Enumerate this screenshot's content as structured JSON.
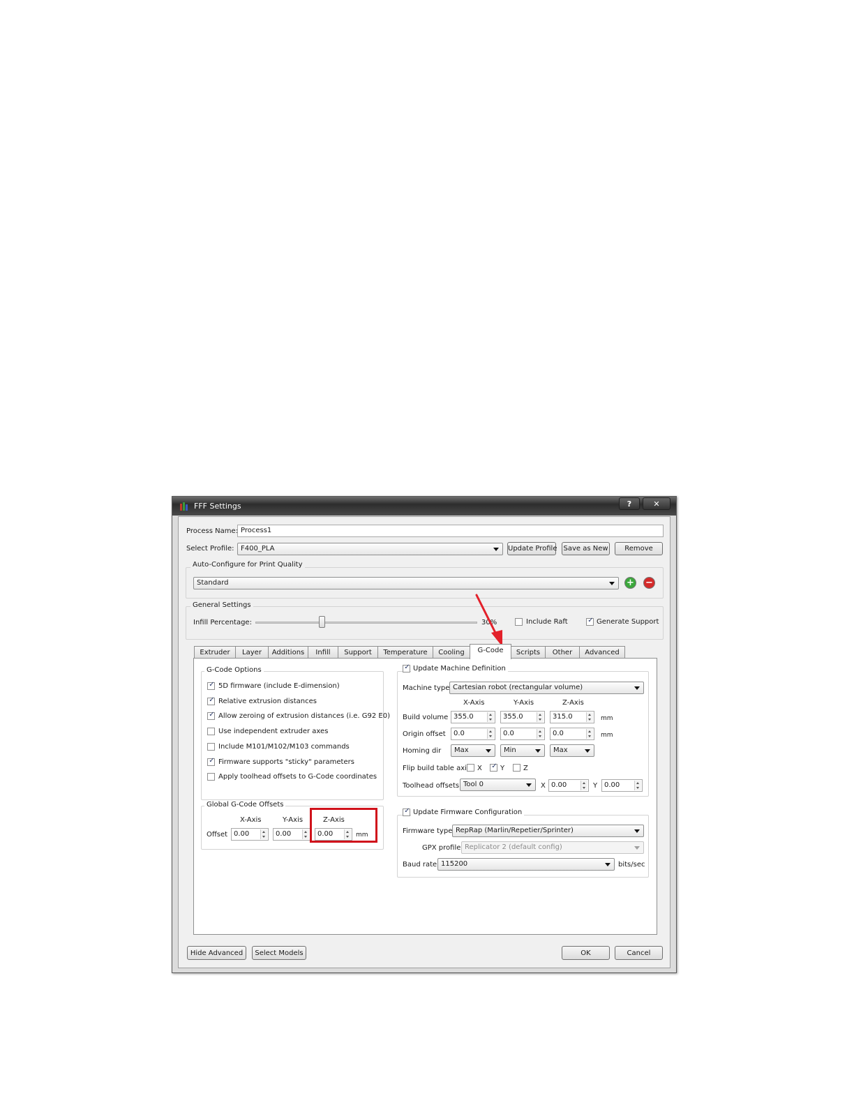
{
  "window": {
    "title": "FFF Settings",
    "help_label": "?",
    "close_label": "✕"
  },
  "process": {
    "label": "Process Name:",
    "value": "Process1"
  },
  "profile": {
    "label": "Select Profile:",
    "value": "F400_PLA",
    "update_label": "Update Profile",
    "save_new_label": "Save as New",
    "remove_label": "Remove"
  },
  "auto_configure": {
    "title": "Auto-Configure for Print Quality",
    "value": "Standard",
    "add_label": "+",
    "remove_label": "−"
  },
  "general": {
    "title": "General Settings",
    "infill_label": "Infill Percentage:",
    "infill_value_label": "30%",
    "infill_fraction": 0.3,
    "raft_label": "Include Raft",
    "raft_checked": false,
    "support_label": "Generate Support",
    "support_checked": true
  },
  "tabs": [
    {
      "label": "Extruder"
    },
    {
      "label": "Layer"
    },
    {
      "label": "Additions"
    },
    {
      "label": "Infill"
    },
    {
      "label": "Support"
    },
    {
      "label": "Temperature"
    },
    {
      "label": "Cooling"
    },
    {
      "label": "G-Code"
    },
    {
      "label": "Scripts"
    },
    {
      "label": "Other"
    },
    {
      "label": "Advanced"
    }
  ],
  "active_tab": "G-Code",
  "gcode_options": {
    "title": "G-Code Options",
    "items": [
      {
        "label": "5D firmware (include E-dimension)",
        "checked": true
      },
      {
        "label": "Relative extrusion distances",
        "checked": true
      },
      {
        "label": "Allow zeroing of extrusion distances (i.e. G92 E0)",
        "checked": true
      },
      {
        "label": "Use independent extruder axes",
        "checked": false
      },
      {
        "label": "Include M101/M102/M103 commands",
        "checked": false
      },
      {
        "label": "Firmware supports \"sticky\" parameters",
        "checked": true
      },
      {
        "label": "Apply toolhead offsets to G-Code coordinates",
        "checked": false
      }
    ]
  },
  "offsets": {
    "title": "Global G-Code Offsets",
    "x_header": "X-Axis",
    "y_header": "Y-Axis",
    "z_header": "Z-Axis",
    "row_label": "Offset",
    "x": "0.00",
    "y": "0.00",
    "z": "0.00",
    "unit": "mm"
  },
  "machine": {
    "title": "Update Machine Definition",
    "checked": true,
    "type_label": "Machine type",
    "type_value": "Cartesian robot (rectangular volume)",
    "x_header": "X-Axis",
    "y_header": "Y-Axis",
    "z_header": "Z-Axis",
    "build_label": "Build volume",
    "build": [
      "355.0",
      "355.0",
      "315.0"
    ],
    "origin_label": "Origin offset",
    "origin": [
      "0.0",
      "0.0",
      "0.0"
    ],
    "unit": "mm",
    "homing_label": "Homing dir",
    "homing": [
      "Max",
      "Min",
      "Max"
    ],
    "flip_label": "Flip build table axis",
    "flip_x_label": "X",
    "flip_x": false,
    "flip_y_label": "Y",
    "flip_y": true,
    "flip_z_label": "Z",
    "flip_z": false,
    "toolhead_label": "Toolhead offsets",
    "toolhead_value": "Tool 0",
    "toolhead_x_label": "X",
    "toolhead_x": "0.00",
    "toolhead_y_label": "Y",
    "toolhead_y": "0.00"
  },
  "firmware": {
    "title": "Update Firmware Configuration",
    "checked": true,
    "type_label": "Firmware type",
    "type_value": "RepRap (Marlin/Repetier/Sprinter)",
    "gpx_label": "GPX profile",
    "gpx_value": "Replicator 2 (default config)",
    "baud_label": "Baud rate",
    "baud_value": "115200",
    "baud_unit": "bits/sec"
  },
  "footer": {
    "hide_advanced": "Hide Advanced",
    "select_models": "Select Models",
    "ok": "OK",
    "cancel": "Cancel"
  },
  "colors": {
    "highlight_box": "#d0121b",
    "arrow": "#e3202a",
    "add_button": "#3ca83c",
    "remove_button": "#d42a2a"
  }
}
